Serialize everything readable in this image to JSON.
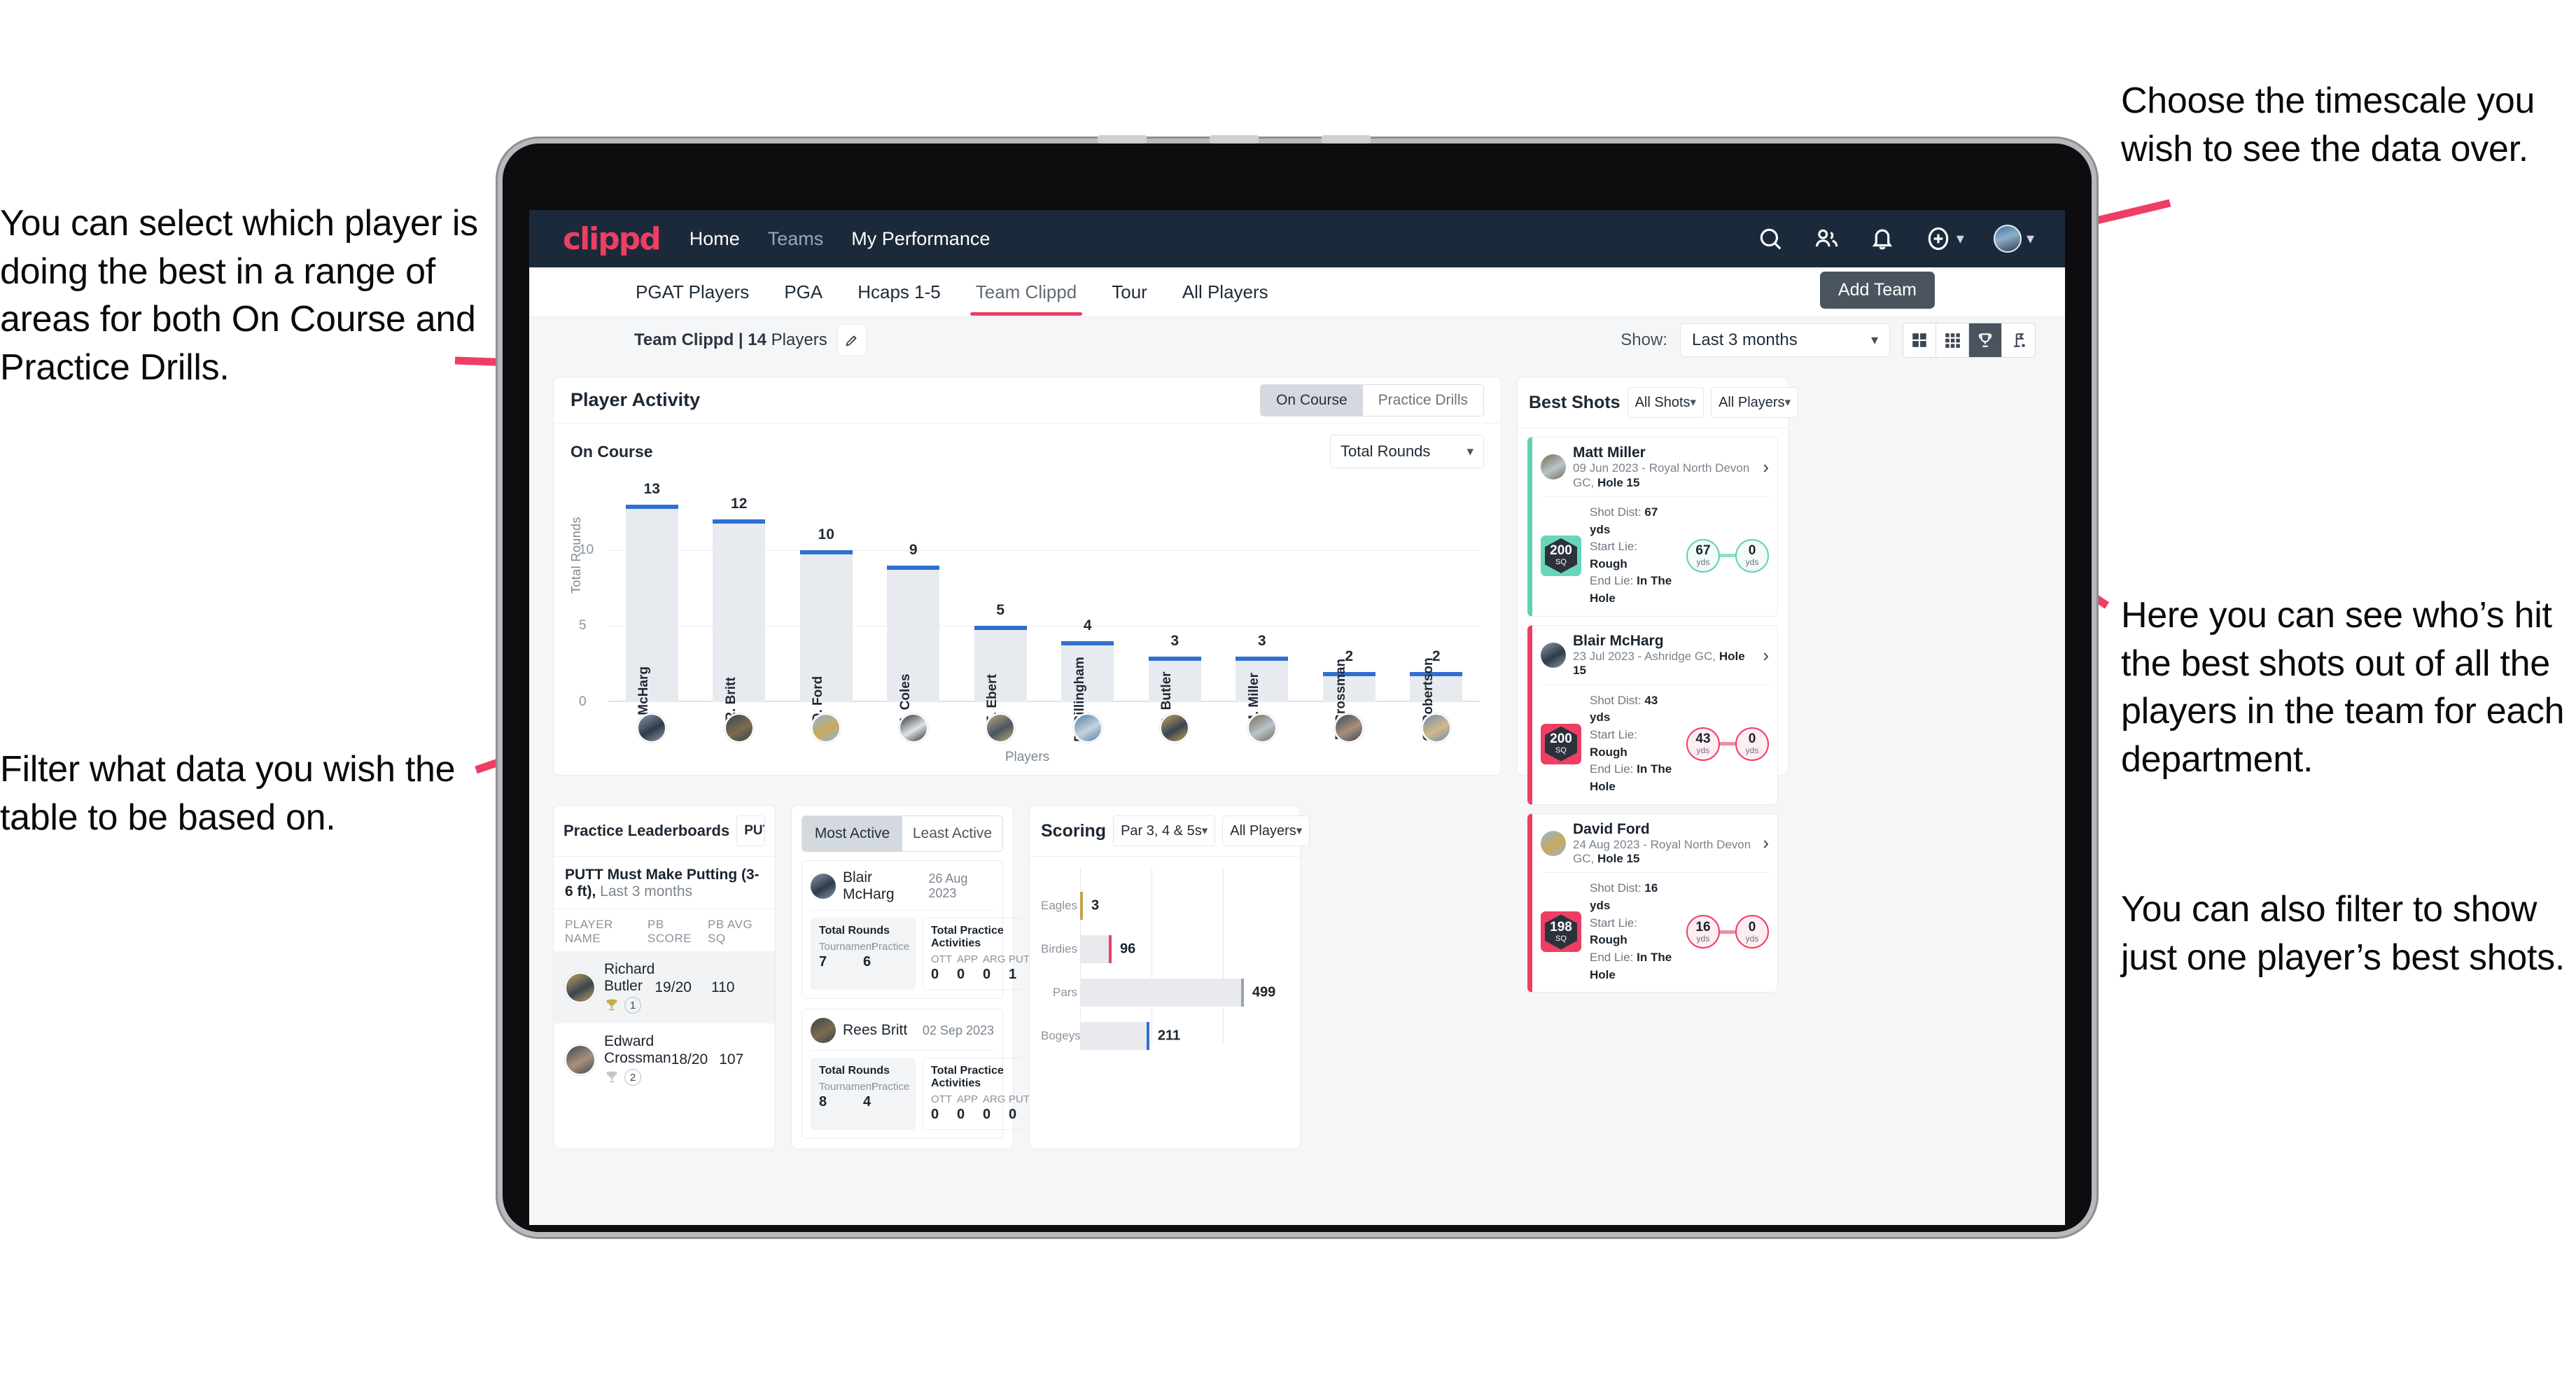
{
  "annotations": {
    "left_top": "You can select which player is doing the best in a range of areas for both On Course and Practice Drills.",
    "left_bottom": "Filter what data you wish the table to be based on.",
    "right_top": "Choose the timescale you wish to see the data over.",
    "right_middle": "Here you can see who’s hit the best shots out of all the players in the team for each department.",
    "right_bottom": "You can also filter to show just one player’s best shots."
  },
  "app": {
    "logo": "clippd",
    "nav": [
      {
        "label": "Home",
        "active": true
      },
      {
        "label": "Teams",
        "active": false
      },
      {
        "label": "My Performance",
        "active": true
      }
    ],
    "icons": {
      "search": "search-icon",
      "people": "people-icon",
      "bell": "bell-icon",
      "plus": "plus-circle-icon",
      "avatar": "avatar"
    },
    "tabs": [
      {
        "label": "PGAT Players",
        "active": false
      },
      {
        "label": "PGA",
        "active": false
      },
      {
        "label": "Hcaps 1-5",
        "active": false
      },
      {
        "label": "Team Clippd",
        "active": true
      },
      {
        "label": "Tour",
        "active": false
      },
      {
        "label": "All Players",
        "active": false
      }
    ],
    "tooltip": "Add Team",
    "subbar": {
      "team_name": "Team Clippd",
      "separator": " | ",
      "player_count": "14",
      "players_word": " Players",
      "edit_icon": "pencil-icon",
      "show_label": "Show:",
      "range_value": "Last 3 months",
      "view_modes": [
        {
          "name": "grid-large-icon",
          "selected": false
        },
        {
          "name": "grid-small-icon",
          "selected": false
        },
        {
          "name": "trophy-icon",
          "selected": true
        },
        {
          "name": "golf-flag-icon",
          "selected": false
        }
      ]
    }
  },
  "player_activity": {
    "title": "Player Activity",
    "segments": [
      {
        "label": "On Course",
        "selected": true
      },
      {
        "label": "Practice Drills",
        "selected": false
      }
    ],
    "sub_label": "On Course",
    "metric_select": "Total Rounds"
  },
  "chart_data": {
    "type": "bar",
    "title": "Player Activity – On Course",
    "categories": [
      "B. McHarg",
      "R. Britt",
      "D. Ford",
      "J. Coles",
      "E. Ebert",
      "D. Billingham",
      "R. Butler",
      "M. Miller",
      "E. Crossman",
      "C. Robertson"
    ],
    "values": [
      13,
      12,
      10,
      9,
      5,
      4,
      3,
      3,
      2,
      2
    ],
    "xlabel": "Players",
    "ylabel": "Total Rounds",
    "ylim": [
      0,
      14
    ],
    "yticks": [
      0,
      5,
      10
    ],
    "grid": true,
    "bar_color": "#e7eaee",
    "cap_color": "#2f6fd0"
  },
  "best_shots": {
    "title": "Best Shots",
    "shot_filter": "All Shots",
    "player_filter": "All Players",
    "shots": [
      {
        "player": "Matt Miller",
        "meta_date": "09 Jun 2023 - Royal North Devon GC,",
        "meta_hole": "Hole 15",
        "quality": "200",
        "quality_unit": "SQ",
        "shot_dist_label": "Shot Dist:",
        "shot_dist": "67 yds",
        "start_lie_label": "Start Lie:",
        "start_lie": "Rough",
        "end_lie_label": "End Lie:",
        "end_lie": "In The Hole",
        "from_val": "67",
        "from_unit": "yds",
        "to_val": "0",
        "to_unit": "yds",
        "accent": "teal"
      },
      {
        "player": "Blair McHarg",
        "meta_date": "23 Jul 2023 - Ashridge GC,",
        "meta_hole": "Hole 15",
        "quality": "200",
        "quality_unit": "SQ",
        "shot_dist_label": "Shot Dist:",
        "shot_dist": "43 yds",
        "start_lie_label": "Start Lie:",
        "start_lie": "Rough",
        "end_lie_label": "End Lie:",
        "end_lie": "In The Hole",
        "from_val": "43",
        "from_unit": "yds",
        "to_val": "0",
        "to_unit": "yds",
        "accent": "pink"
      },
      {
        "player": "David Ford",
        "meta_date": "24 Aug 2023 - Royal North Devon GC,",
        "meta_hole": "Hole 15",
        "quality": "198",
        "quality_unit": "SQ",
        "shot_dist_label": "Shot Dist:",
        "shot_dist": "16 yds",
        "start_lie_label": "Start Lie:",
        "start_lie": "Rough",
        "end_lie_label": "End Lie:",
        "end_lie": "In The Hole",
        "from_val": "16",
        "from_unit": "yds",
        "to_val": "0",
        "to_unit": "yds",
        "accent": "pink"
      }
    ]
  },
  "practice_leaderboards": {
    "title": "Practice Leaderboards",
    "drill_select": "PUTT Must Make Putting ...",
    "subtitle_bold": "PUTT Must Make Putting (3-6 ft),",
    "subtitle_rest": " Last 3 months",
    "columns": [
      "PLAYER NAME",
      "PB SCORE",
      "PB AVG SQ"
    ],
    "rows": [
      {
        "name": "Richard Butler",
        "rank": "1",
        "medal": "gold",
        "pb_score": "19/20",
        "pb_avg_sq": "110"
      },
      {
        "name": "Edward Crossman",
        "rank": "2",
        "medal": "silver",
        "pb_score": "18/20",
        "pb_avg_sq": "107"
      }
    ]
  },
  "activity_panel": {
    "tabs": [
      {
        "label": "Most Active",
        "selected": true
      },
      {
        "label": "Least Active",
        "selected": false
      }
    ],
    "cards": [
      {
        "name": "Blair McHarg",
        "date": "26 Aug 2023",
        "rounds_title": "Total Rounds",
        "rounds_keys": [
          "Tournament",
          "Practice"
        ],
        "rounds_vals": [
          "7",
          "6"
        ],
        "practice_title": "Total Practice Activities",
        "practice_keys": [
          "OTT",
          "APP",
          "ARG",
          "PUTT"
        ],
        "practice_vals": [
          "0",
          "0",
          "0",
          "1"
        ]
      },
      {
        "name": "Rees Britt",
        "date": "02 Sep 2023",
        "rounds_title": "Total Rounds",
        "rounds_keys": [
          "Tournament",
          "Practice"
        ],
        "rounds_vals": [
          "8",
          "4"
        ],
        "practice_title": "Total Practice Activities",
        "practice_keys": [
          "OTT",
          "APP",
          "ARG",
          "PUTT"
        ],
        "practice_vals": [
          "0",
          "0",
          "0",
          "0"
        ]
      }
    ]
  },
  "scoring": {
    "title": "Scoring",
    "par_filter": "Par 3, 4 & 5s",
    "player_filter": "All Players",
    "chart_data": {
      "type": "bar",
      "orientation": "horizontal",
      "title": "Scoring",
      "categories": [
        "Eagles",
        "Birdies",
        "Pars",
        "Bogeys"
      ],
      "values": [
        3,
        96,
        499,
        211
      ],
      "colors": [
        "#c4a24a",
        "#ee3e63",
        "#9aa2ab",
        "#2f6fd0"
      ],
      "xlim": [
        0,
        640
      ],
      "grid": true
    }
  }
}
